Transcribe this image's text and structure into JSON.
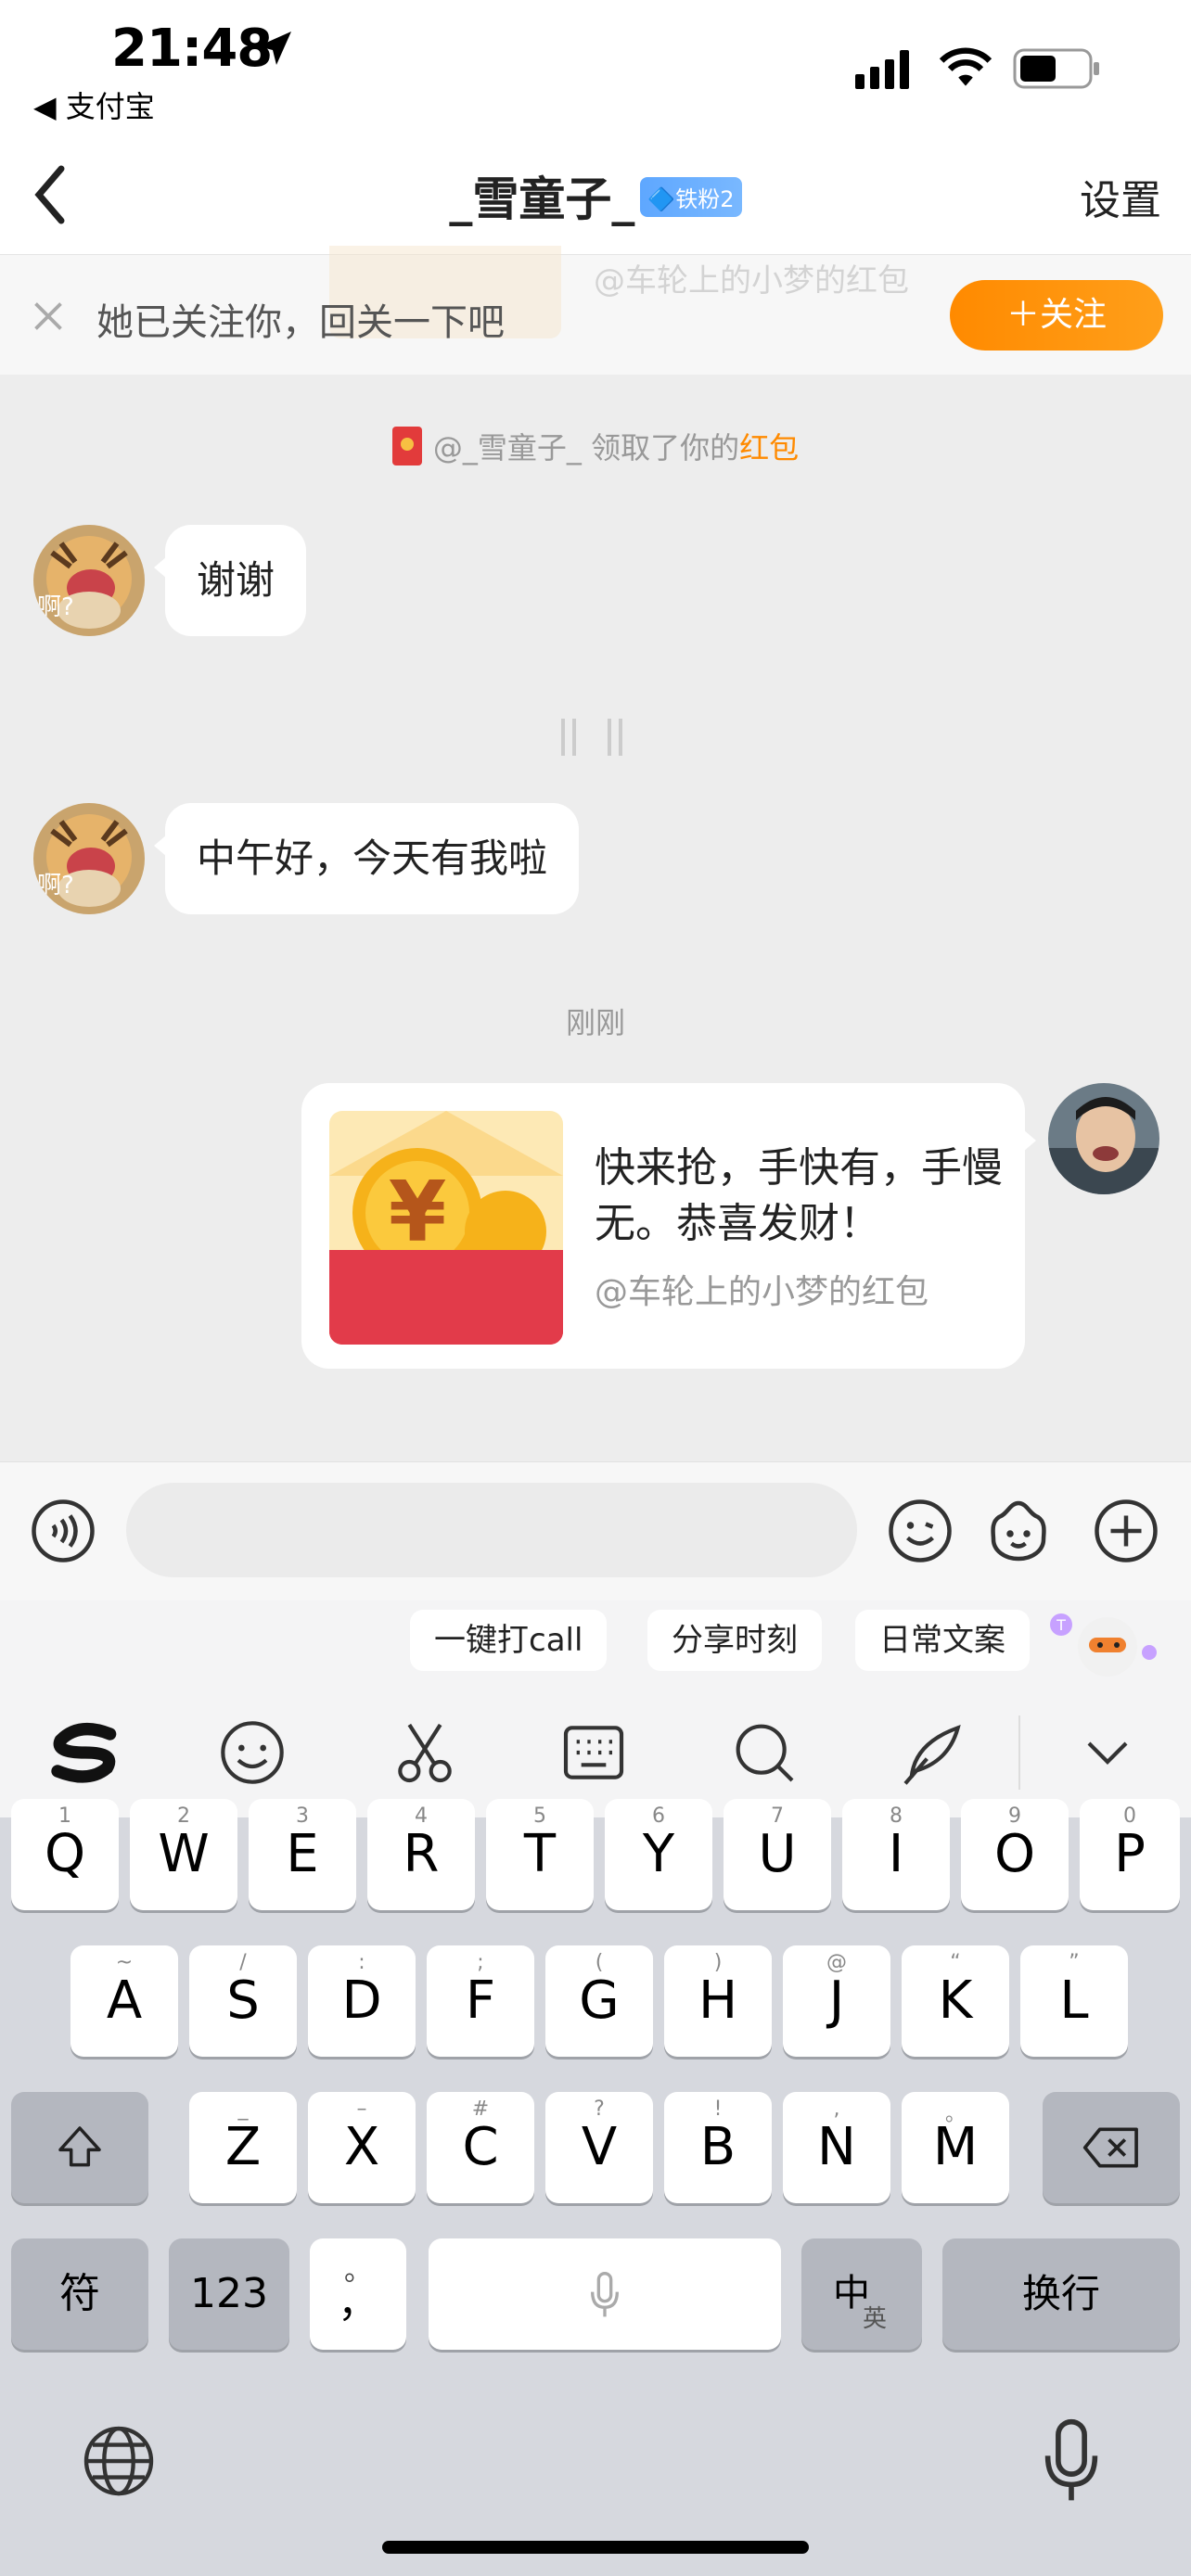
{
  "status_bar": {
    "time": "21:48",
    "back_app": "◀ 支付宝"
  },
  "nav": {
    "title": "_雪童子_",
    "badge": "🔷铁粉2",
    "settings": "设置"
  },
  "follow_bar": {
    "text": "她已关注你，回关一下吧",
    "button": "＋关注",
    "ghost_text": "@车轮上的小梦的红包"
  },
  "chat": {
    "system_message": {
      "prefix": "@_雪童子_ 领取了你的",
      "highlight": "红包"
    },
    "messages": [
      {
        "from": "other",
        "avatar_label": "啊?",
        "text": "谢谢"
      },
      {
        "from": "other",
        "avatar_label": "啊?",
        "text": "中午好，今天有我啦"
      }
    ],
    "timestamp": "刚刚",
    "red_packet": {
      "text": "快来抢，手快有，手慢无。恭喜发财！",
      "sender": "@车轮上的小梦的红包"
    }
  },
  "input": {
    "placeholder": ""
  },
  "keyboard": {
    "suggestions": [
      "一键打call",
      "分享时刻",
      "日常文案"
    ],
    "row1": [
      {
        "k": "Q",
        "h": "1"
      },
      {
        "k": "W",
        "h": "2"
      },
      {
        "k": "E",
        "h": "3"
      },
      {
        "k": "R",
        "h": "4"
      },
      {
        "k": "T",
        "h": "5"
      },
      {
        "k": "Y",
        "h": "6"
      },
      {
        "k": "U",
        "h": "7"
      },
      {
        "k": "I",
        "h": "8"
      },
      {
        "k": "O",
        "h": "9"
      },
      {
        "k": "P",
        "h": "0"
      }
    ],
    "row2": [
      {
        "k": "A",
        "h": "~"
      },
      {
        "k": "S",
        "h": "/"
      },
      {
        "k": "D",
        "h": ":"
      },
      {
        "k": "F",
        "h": ";"
      },
      {
        "k": "G",
        "h": "("
      },
      {
        "k": "H",
        "h": ")"
      },
      {
        "k": "J",
        "h": "@"
      },
      {
        "k": "K",
        "h": "“"
      },
      {
        "k": "L",
        "h": "”"
      }
    ],
    "row3": [
      {
        "k": "Z",
        "h": "_"
      },
      {
        "k": "X",
        "h": "–"
      },
      {
        "k": "C",
        "h": "#"
      },
      {
        "k": "V",
        "h": "?"
      },
      {
        "k": "B",
        "h": "!"
      },
      {
        "k": "N",
        "h": ","
      },
      {
        "k": "M",
        "h": "。"
      }
    ],
    "symbols_key": "符",
    "numbers_key": "123",
    "punct_key": "，",
    "punct_hint": "。",
    "lang_key": "中",
    "lang_sub": "英",
    "return_key": "换行"
  }
}
